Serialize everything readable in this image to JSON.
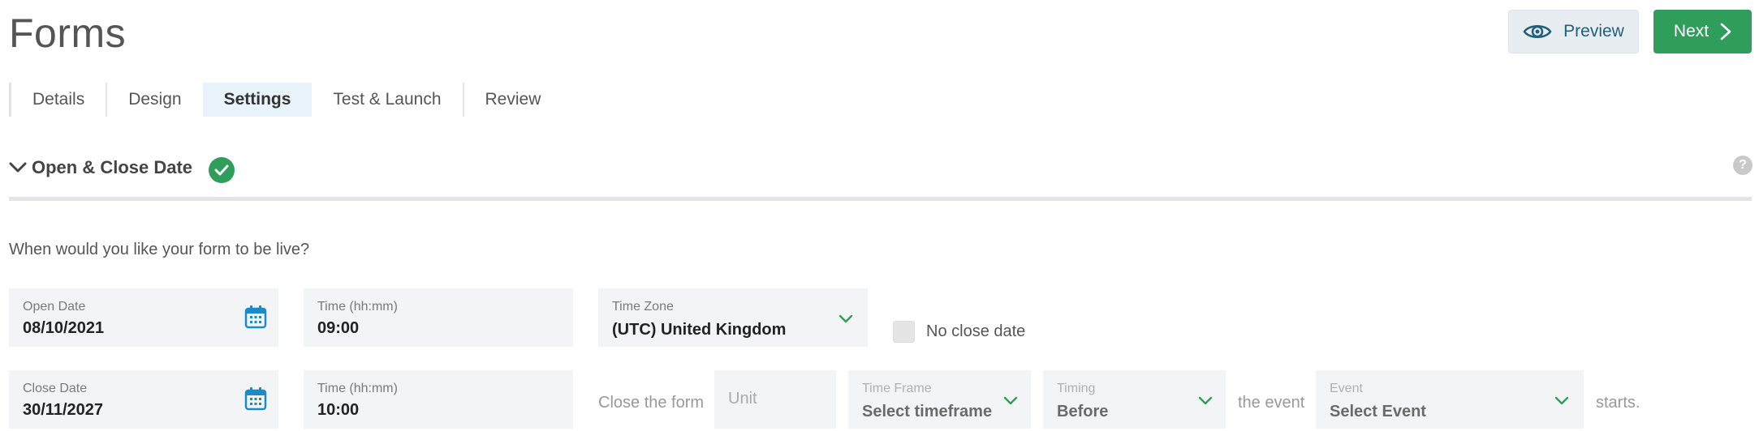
{
  "header": {
    "title": "Forms",
    "preview_label": "Preview",
    "next_label": "Next"
  },
  "tabs": [
    {
      "label": "Details",
      "active": false
    },
    {
      "label": "Design",
      "active": false
    },
    {
      "label": "Settings",
      "active": true
    },
    {
      "label": "Test & Launch",
      "active": false
    },
    {
      "label": "Review",
      "active": false
    }
  ],
  "section": {
    "title": "Open & Close Date",
    "complete": true,
    "help_label": "?"
  },
  "question": "When would you like your form to be live?",
  "open": {
    "date_label": "Open Date",
    "date_value": "08/10/2021",
    "time_label": "Time (hh:mm)",
    "time_value": "09:00",
    "timezone_label": "Time Zone",
    "timezone_value": "(UTC) United Kingdom",
    "no_close_label": "No close date",
    "no_close_checked": false
  },
  "close": {
    "date_label": "Close Date",
    "date_value": "30/11/2027",
    "time_label": "Time (hh:mm)",
    "time_value": "10:00",
    "close_form_text": "Close the form",
    "unit_placeholder": "Unit",
    "timeframe_label": "Time Frame",
    "timeframe_value": "Select timeframe",
    "timing_label": "Timing",
    "timing_value": "Before",
    "the_event_text": "the event",
    "event_label": "Event",
    "event_value": "Select Event",
    "starts_text": "starts."
  },
  "colors": {
    "accent_green": "#2f9e5a",
    "calendar_blue": "#1a8ac9",
    "active_tab_bg": "#e8f3fb",
    "preview_text": "#1f5f7a"
  },
  "icons": {
    "preview": "eye-icon",
    "next": "chevron-right-icon",
    "section_toggle": "chevron-down-icon",
    "complete": "check-circle-icon",
    "help": "help-icon",
    "date": "calendar-icon",
    "dropdown": "chevron-down-icon"
  }
}
